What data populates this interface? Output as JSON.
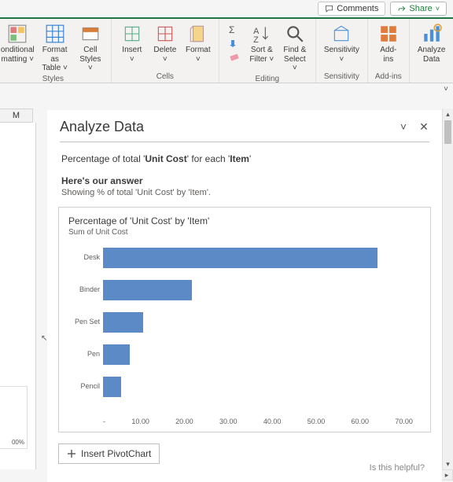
{
  "titlebar": {
    "comments": "Comments",
    "share": "Share"
  },
  "ribbon": {
    "styles": {
      "label": "Styles",
      "conditional": "onditional\nmatting ˅",
      "formatAs": "Format as\nTable ˅",
      "cellStyles": "Cell\nStyles ˅"
    },
    "cells": {
      "label": "Cells",
      "insert": "Insert\n˅",
      "delete": "Delete\n˅",
      "format": "Format\n˅"
    },
    "editing": {
      "label": "Editing",
      "sortFilter": "Sort &\nFilter ˅",
      "findSelect": "Find &\nSelect ˅"
    },
    "sensitivity": {
      "label": "Sensitivity",
      "btn": "Sensitivity\n˅"
    },
    "addins": {
      "label": "Add-ins",
      "btn": "Add-ins"
    },
    "analyze": {
      "btn": "Analyze\nData"
    }
  },
  "column_letter": "M",
  "left_pct": "00%",
  "pane": {
    "title": "Analyze Data",
    "question_pre": "Percentage of total '",
    "question_b1": "Unit Cost",
    "question_mid": "' for each '",
    "question_b2": "Item",
    "question_post": "'",
    "answer_head": "Here's our answer",
    "answer_sub": "Showing % of total 'Unit Cost' by 'Item'.",
    "card_title": "Percentage of 'Unit Cost' by 'Item'",
    "card_sub": "Sum of Unit Cost",
    "pivot_btn": "Insert PivotChart",
    "helpful": "Is this helpful?"
  },
  "chart_data": {
    "type": "bar",
    "categories": [
      "Desk",
      "Binder",
      "Pen Set",
      "Pen",
      "Pencil"
    ],
    "values": [
      62,
      20,
      9,
      6,
      4
    ],
    "title": "Percentage of 'Unit Cost' by 'Item'",
    "xlabel": "",
    "ylabel": "",
    "xticks": [
      "-",
      "10.00",
      "20.00",
      "30.00",
      "40.00",
      "50.00",
      "60.00",
      "70.00"
    ],
    "xlim": [
      0,
      70
    ]
  }
}
